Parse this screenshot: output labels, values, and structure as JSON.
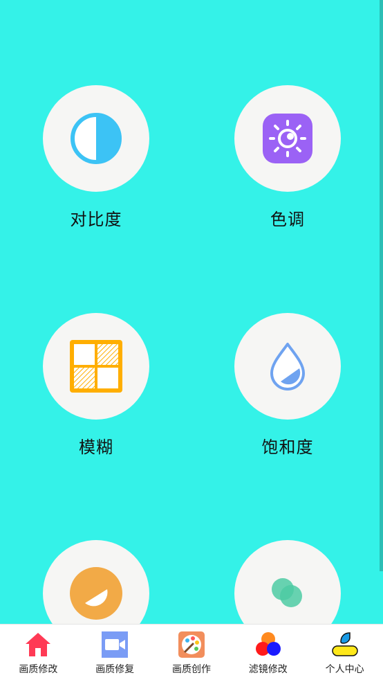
{
  "tools": [
    {
      "label": "对比度",
      "icon": "contrast-icon"
    },
    {
      "label": "色调",
      "icon": "brightness-sun-icon"
    },
    {
      "label": "模糊",
      "icon": "blur-grid-icon"
    },
    {
      "label": "饱和度",
      "icon": "saturation-drop-icon"
    },
    {
      "label": "",
      "icon": "exposure-icon"
    },
    {
      "label": "",
      "icon": "overlay-circles-icon"
    }
  ],
  "tabbar": {
    "items": [
      {
        "label": "画质修改",
        "icon": "home-icon"
      },
      {
        "label": "画质修复",
        "icon": "video-camera-icon"
      },
      {
        "label": "画质创作",
        "icon": "palette-icon"
      },
      {
        "label": "滤镜修改",
        "icon": "filter-circles-icon"
      },
      {
        "label": "个人中心",
        "icon": "profile-icon"
      }
    ]
  },
  "colors": {
    "background": "#34F2E8",
    "card": "#F6F6F4",
    "contrast": "#3CC3F5",
    "tone": "#9B62F5",
    "blur": "#FFAE00",
    "saturation": "#6FA3F0",
    "exposure": "#F2AA47",
    "overlay": "#4DCBA3"
  }
}
